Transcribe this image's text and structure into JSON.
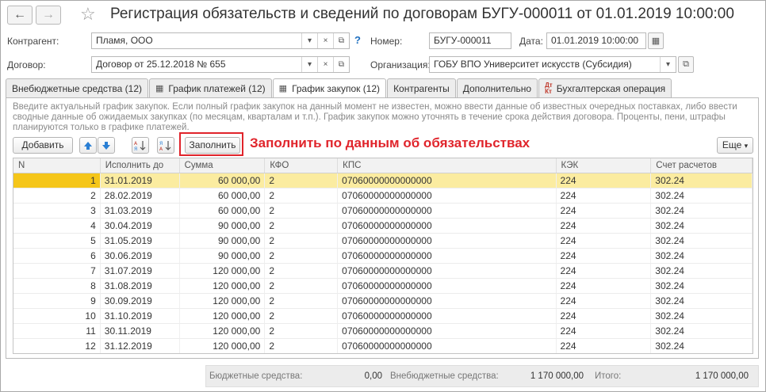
{
  "window": {
    "title": "Регистрация обязательств и сведений по договорам БУГУ-000011 от 01.01.2019 10:00:00"
  },
  "form": {
    "contractor_label": "Контрагент:",
    "contractor_value": "Пламя, ООО",
    "number_label": "Номер:",
    "number_value": "БУГУ-000011",
    "date_label": "Дата:",
    "date_value": "01.01.2019 10:00:00",
    "contract_label": "Договор:",
    "contract_value": "Договор от 25.12.2018 № 655",
    "org_label": "Организация:",
    "org_value": "ГОБУ ВПО Университет искусств (Субсидия)"
  },
  "tabs": [
    {
      "label": "Внебюджетные средства (12)"
    },
    {
      "label": "График платежей (12)"
    },
    {
      "label": "График закупок (12)"
    },
    {
      "label": "Контрагенты"
    },
    {
      "label": "Дополнительно"
    },
    {
      "label": "Бухгалтерская операция"
    }
  ],
  "dt_kt": {
    "dt": "Дт",
    "kt": "Кт"
  },
  "info_text": "Введите актуальный график закупок. Если полный график закупок на данный момент не известен, можно ввести данные об известных очередных поставках, либо ввести сводные данные об ожидаемых закупках (по месяцам, кварталам и т.п.). График закупок можно уточнять в течение срока действия договора. Проценты, пени, штрафы планируются только в графике платежей.",
  "toolbar": {
    "add_label": "Добавить",
    "fill_label": "Заполнить",
    "more_label": "Еще",
    "annotation": "Заполнить по данным об обязательствах"
  },
  "table": {
    "columns": [
      "N",
      "Исполнить до",
      "Сумма",
      "КФО",
      "КПС",
      "КЭК",
      "Счет расчетов"
    ],
    "rows": [
      [
        "1",
        "31.01.2019",
        "60 000,00",
        "2",
        "07060000000000000",
        "224",
        "302.24"
      ],
      [
        "2",
        "28.02.2019",
        "60 000,00",
        "2",
        "07060000000000000",
        "224",
        "302.24"
      ],
      [
        "3",
        "31.03.2019",
        "60 000,00",
        "2",
        "07060000000000000",
        "224",
        "302.24"
      ],
      [
        "4",
        "30.04.2019",
        "90 000,00",
        "2",
        "07060000000000000",
        "224",
        "302.24"
      ],
      [
        "5",
        "31.05.2019",
        "90 000,00",
        "2",
        "07060000000000000",
        "224",
        "302.24"
      ],
      [
        "6",
        "30.06.2019",
        "90 000,00",
        "2",
        "07060000000000000",
        "224",
        "302.24"
      ],
      [
        "7",
        "31.07.2019",
        "120 000,00",
        "2",
        "07060000000000000",
        "224",
        "302.24"
      ],
      [
        "8",
        "31.08.2019",
        "120 000,00",
        "2",
        "07060000000000000",
        "224",
        "302.24"
      ],
      [
        "9",
        "30.09.2019",
        "120 000,00",
        "2",
        "07060000000000000",
        "224",
        "302.24"
      ],
      [
        "10",
        "31.10.2019",
        "120 000,00",
        "2",
        "07060000000000000",
        "224",
        "302.24"
      ],
      [
        "11",
        "30.11.2019",
        "120 000,00",
        "2",
        "07060000000000000",
        "224",
        "302.24"
      ],
      [
        "12",
        "31.12.2019",
        "120 000,00",
        "2",
        "07060000000000000",
        "224",
        "302.24"
      ]
    ]
  },
  "footer": {
    "budget_label": "Бюджетные средства:",
    "budget_value": "0,00",
    "extra_label": "Внебюджетные средства:",
    "extra_value": "1 170 000,00",
    "total_label": "Итого:",
    "total_value": "1 170 000,00"
  },
  "colors": {
    "accent_red": "#e0242b",
    "selected_row": "#fbeca0",
    "selected_cell": "#f5c61a",
    "arrow_blue": "#2a7fd4"
  }
}
